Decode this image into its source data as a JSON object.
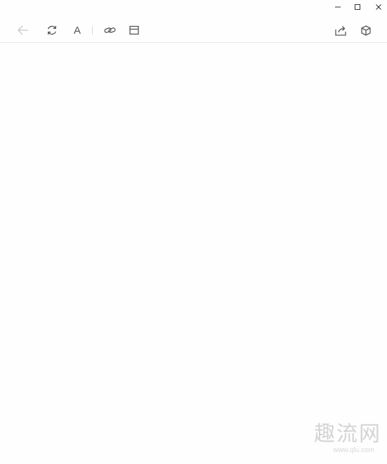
{
  "window_controls": {
    "minimize_icon": "minimize-icon",
    "maximize_icon": "maximize-icon",
    "close_icon": "close-icon"
  },
  "toolbar": {
    "back_icon": "arrow-left-icon",
    "refresh_icon": "refresh-icon",
    "font_label": "A",
    "link_icon": "link-icon",
    "layout_icon": "layout-icon",
    "share_icon": "share-icon",
    "cube_icon": "cube-icon"
  },
  "watermark": {
    "text": "趣流网",
    "url": "www.qlu.com"
  },
  "colors": {
    "background": "#fefefe",
    "icon": "#555555",
    "icon_disabled": "#c8c8c8",
    "divider": "#e9e9e9"
  }
}
